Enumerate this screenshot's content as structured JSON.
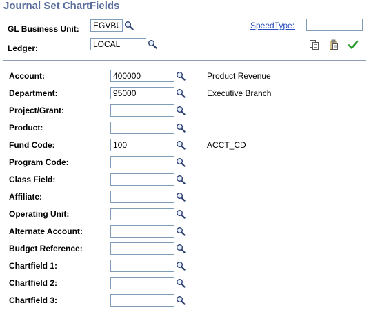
{
  "page_title": "Journal Set ChartFields",
  "header": {
    "business_unit": {
      "label": "GL Business Unit:",
      "value": "EGVBU"
    },
    "ledger": {
      "label": "Ledger:",
      "value": "LOCAL"
    },
    "speedtype": {
      "label": "SpeedType:",
      "value": ""
    },
    "toolbar_icons": [
      "copy-icon",
      "paste-icon",
      "checkmark-icon"
    ],
    "lookup_icon": "magnifier-icon"
  },
  "chartfields": [
    {
      "label": "Account:",
      "value": "400000",
      "description": "Product Revenue"
    },
    {
      "label": "Department:",
      "value": "95000",
      "description": "Executive Branch"
    },
    {
      "label": "Project/Grant:",
      "value": "",
      "description": ""
    },
    {
      "label": "Product:",
      "value": "",
      "description": ""
    },
    {
      "label": "Fund Code:",
      "value": "100",
      "description": "ACCT_CD"
    },
    {
      "label": "Program Code:",
      "value": "",
      "description": ""
    },
    {
      "label": "Class Field:",
      "value": "",
      "description": ""
    },
    {
      "label": "Affiliate:",
      "value": "",
      "description": ""
    },
    {
      "label": "Operating Unit:",
      "value": "",
      "description": ""
    },
    {
      "label": "Alternate Account:",
      "value": "",
      "description": ""
    },
    {
      "label": "Budget Reference:",
      "value": "",
      "description": ""
    },
    {
      "label": "Chartfield 1:",
      "value": "",
      "description": ""
    },
    {
      "label": "Chartfield 2:",
      "value": "",
      "description": ""
    },
    {
      "label": "Chartfield 3:",
      "value": "",
      "description": ""
    }
  ],
  "colors": {
    "title": "#5a6e9c",
    "link": "#2a4fc0",
    "input_border": "#7f9db9",
    "check": "#2e9a2e"
  }
}
